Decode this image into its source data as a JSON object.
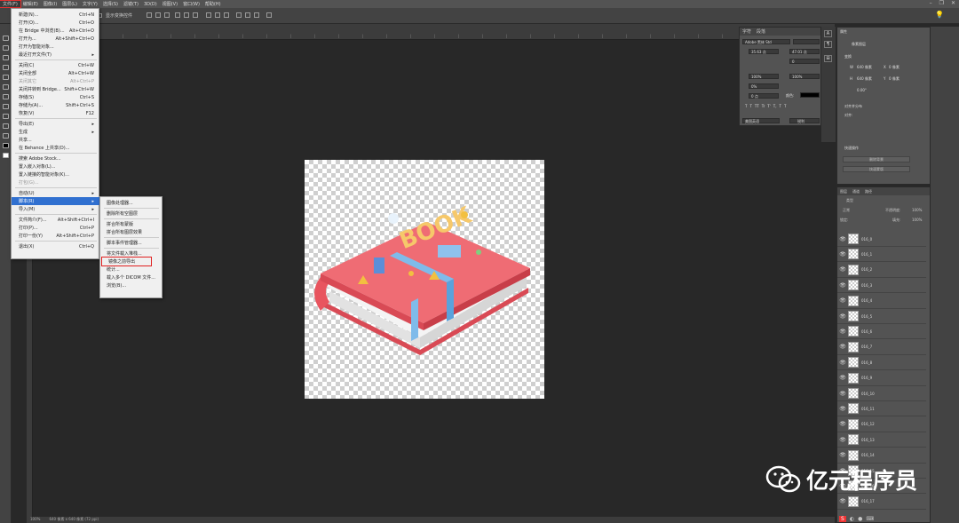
{
  "menubar": {
    "items": [
      "文件(F)",
      "编辑(E)",
      "图像(I)",
      "图层(L)",
      "文字(Y)",
      "选择(S)",
      "滤镜(T)",
      "3D(D)",
      "视图(V)",
      "窗口(W)",
      "帮助(H)"
    ],
    "ps_logo": "Ps"
  },
  "options_bar": {
    "show_transform": "显示变换控件"
  },
  "file_menu": {
    "items": [
      {
        "label": "新建(N)...",
        "shortcut": "Ctrl+N"
      },
      {
        "label": "打开(O)...",
        "shortcut": "Ctrl+O"
      },
      {
        "label": "在 Bridge 中浏览(B)...",
        "shortcut": "Alt+Ctrl+O"
      },
      {
        "label": "打开为...",
        "shortcut": "Alt+Shift+Ctrl+O"
      },
      {
        "label": "打开为智能对象...",
        "shortcut": ""
      },
      {
        "label": "最近打开文件(T)",
        "shortcut": "",
        "arrow": true
      },
      {
        "label": "关闭(C)",
        "shortcut": "Ctrl+W"
      },
      {
        "label": "关闭全部",
        "shortcut": "Alt+Ctrl+W"
      },
      {
        "label": "关闭其它",
        "shortcut": "Alt+Ctrl+P",
        "disabled": true
      },
      {
        "label": "关闭并转到 Bridge...",
        "shortcut": "Shift+Ctrl+W"
      },
      {
        "label": "存储(S)",
        "shortcut": "Ctrl+S"
      },
      {
        "label": "存储为(A)...",
        "shortcut": "Shift+Ctrl+S"
      },
      {
        "label": "恢复(V)",
        "shortcut": "F12"
      },
      {
        "label": "导出(E)",
        "shortcut": "",
        "arrow": true
      },
      {
        "label": "生成",
        "shortcut": "",
        "arrow": true
      },
      {
        "label": "共享...",
        "shortcut": ""
      },
      {
        "label": "在 Behance 上共享(D)...",
        "shortcut": ""
      },
      {
        "label": "搜索 Adobe Stock...",
        "shortcut": ""
      },
      {
        "label": "置入嵌入对象(L)...",
        "shortcut": ""
      },
      {
        "label": "置入链接的智能对象(K)...",
        "shortcut": ""
      },
      {
        "label": "打包(G)...",
        "shortcut": "",
        "disabled": true
      },
      {
        "label": "自动(U)",
        "shortcut": "",
        "arrow": true
      },
      {
        "label": "脚本(R)",
        "shortcut": "",
        "arrow": true,
        "highlight": true
      },
      {
        "label": "导入(M)",
        "shortcut": "",
        "arrow": true
      },
      {
        "label": "文件简介(F)...",
        "shortcut": "Alt+Shift+Ctrl+I"
      },
      {
        "label": "打印(P)...",
        "shortcut": "Ctrl+P"
      },
      {
        "label": "打印一份(Y)",
        "shortcut": "Alt+Shift+Ctrl+P"
      },
      {
        "label": "退出(X)",
        "shortcut": "Ctrl+Q"
      }
    ]
  },
  "script_submenu": {
    "items": [
      "图像处理器...",
      "删除所有空图层",
      "拼合所有蒙版",
      "拼合所有图层效果",
      "脚本事件管理器...",
      "将文件载入堆栈...",
      "将图层导出到文件...",
      "统计...",
      "载入多个 DICOM 文件...",
      "浏览(B)..."
    ],
    "boxed_item": "图层导出到文件...",
    "visible_items": [
      "图像处理器...",
      "删除所有空图层",
      "拼合所有蒙版",
      "拼合所有图层效果",
      "脚本事件管理器...",
      "将文件载入堆栈...",
      "镜像之前导出",
      "统计...",
      "载入多个 DICOM 文件...",
      "浏览(B)..."
    ]
  },
  "character_panel": {
    "tabs": [
      "字符",
      "段落"
    ],
    "font": "Adobe 黑体 Std",
    "size": "35.63 点",
    "leading": "47.01 点",
    "tracking": "0",
    "scale_v": "100%",
    "scale_h": "100%",
    "kerning": "0%",
    "baseline": "0 点",
    "color_label": "颜色:",
    "language": "美国英语",
    "aa": "锐利",
    "styles": [
      "T",
      "T",
      "TT",
      "Tr",
      "T'",
      "T,",
      "T",
      "T"
    ]
  },
  "properties_panel": {
    "title": "属性",
    "subtitle": "像素图层",
    "transform": "变换",
    "w_label": "W",
    "w_value": "640 像素",
    "h_label": "H",
    "h_value": "640 像素",
    "x_label": "X",
    "x_value": "0 像素",
    "y_label": "Y",
    "y_value": "0 像素",
    "angle": "0.00°",
    "align_title": "对齐并分布",
    "align_label": "对齐:",
    "quick_actions": "快速操作",
    "btn1": "删除背景",
    "btn2": "快速蒙版"
  },
  "layers_panel": {
    "tabs": [
      "图层",
      "通道",
      "路径"
    ],
    "filter_kind": "类型",
    "blend_mode": "正常",
    "opacity_label": "不透明度:",
    "opacity": "100%",
    "lock_label": "锁定:",
    "fill_label": "填充:",
    "fill": "100%",
    "layers": [
      "016_0",
      "016_1",
      "016_2",
      "016_3",
      "016_4",
      "016_5",
      "016_6",
      "016_7",
      "016_8",
      "016_9",
      "016_10",
      "016_11",
      "016_12",
      "016_13",
      "016_14",
      "016_15",
      "016_16",
      "016_17"
    ]
  },
  "status_bar": {
    "zoom": "100%",
    "doc": "640 像素 x 640 像素 (72 ppi)"
  },
  "watermark": {
    "text": "亿元程序员"
  },
  "colors": {
    "panel": "#535353",
    "workspace": "#282828",
    "highlight": "#3070d0",
    "book_red": "#e8555f"
  }
}
